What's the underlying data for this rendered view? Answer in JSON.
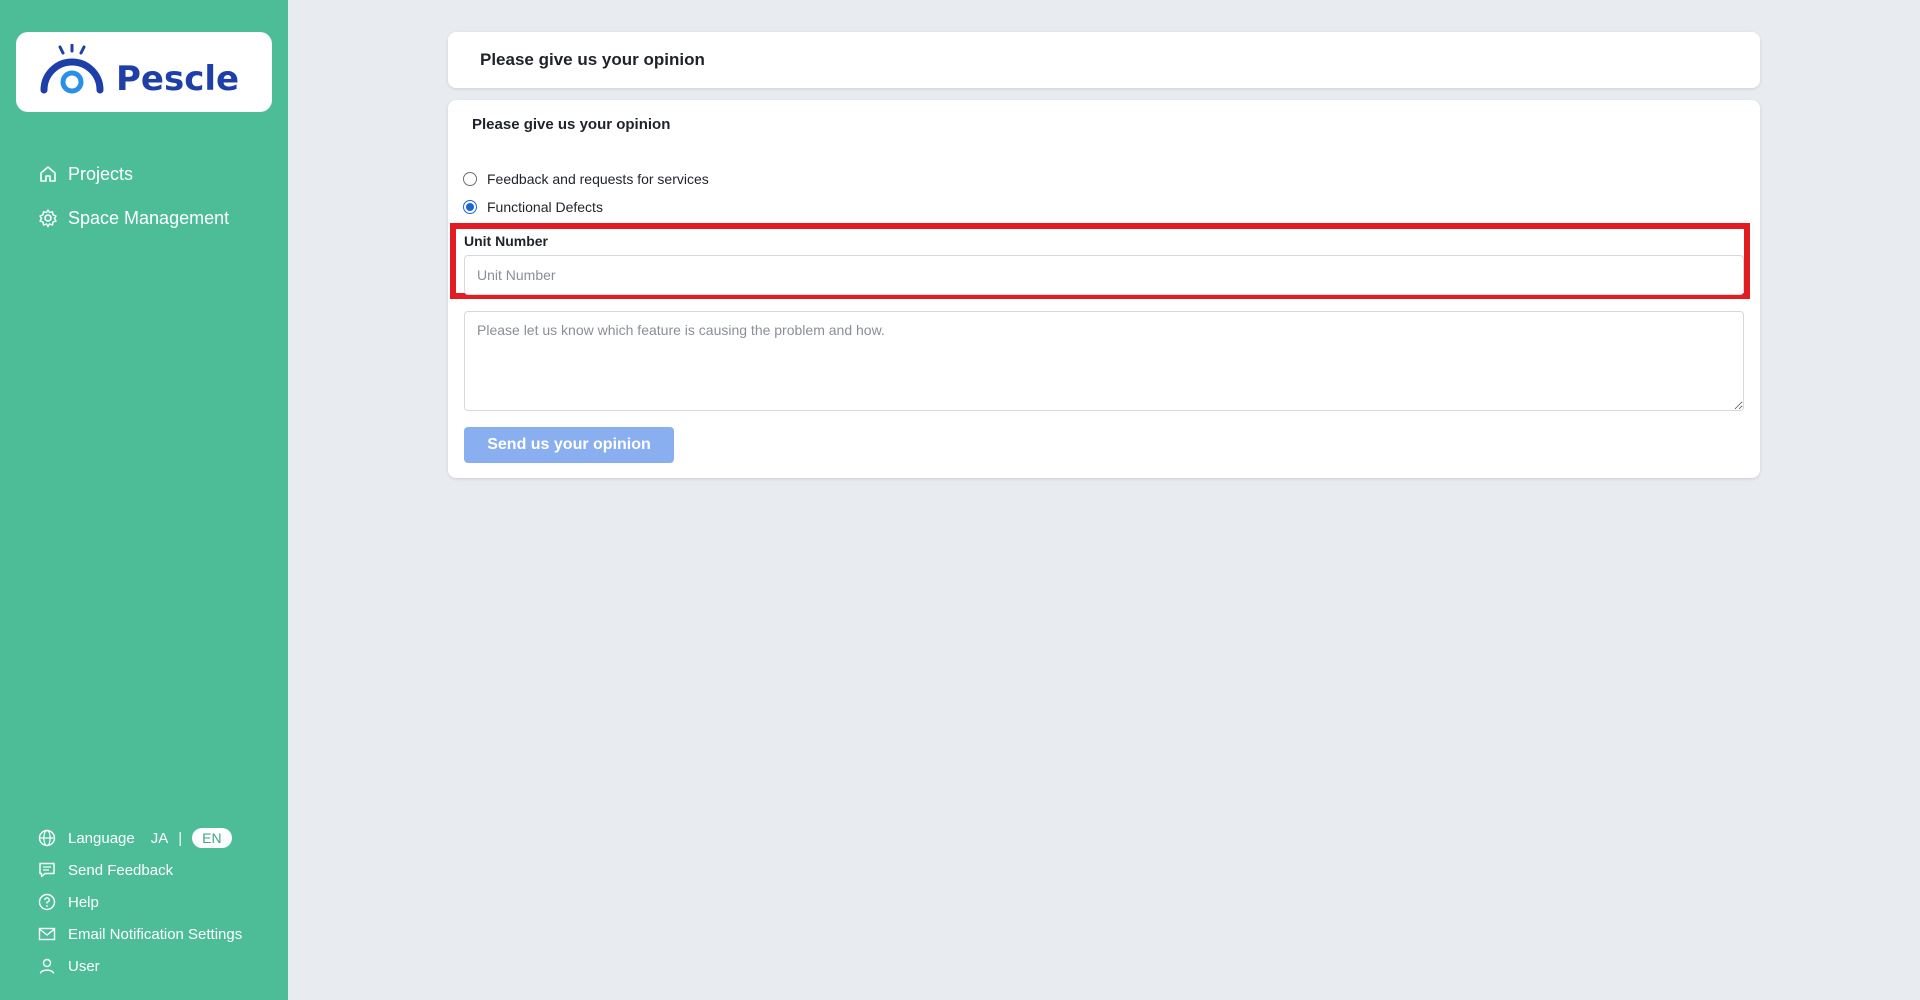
{
  "app": {
    "logo_text": "Pescle",
    "colors": {
      "sidebar": "#4dbd98",
      "accent": "#1a66d9",
      "highlight": "#e31b23",
      "button": "#8aaff0"
    }
  },
  "sidebar": {
    "nav": [
      {
        "label": "Projects",
        "icon": "home-icon"
      },
      {
        "label": "Space Management",
        "icon": "gear-icon"
      }
    ],
    "bottom": {
      "language": {
        "label": "Language",
        "ja": "JA",
        "separator": "|",
        "en": "EN",
        "selected": "EN"
      },
      "send_feedback": "Send Feedback",
      "help": "Help",
      "email_settings": "Email Notification Settings",
      "user": "User"
    }
  },
  "header": {
    "title": "Please give us your opinion"
  },
  "form": {
    "title": "Please give us your opinion",
    "options": [
      {
        "label": "Feedback and requests for services",
        "checked": false
      },
      {
        "label": "Functional Defects",
        "checked": true
      }
    ],
    "unit_label": "Unit Number",
    "unit_placeholder": "Unit Number",
    "unit_value": "",
    "description_placeholder": "Please let us know which feature is causing the problem and how.",
    "description_value": "",
    "submit_label": "Send us your opinion"
  }
}
